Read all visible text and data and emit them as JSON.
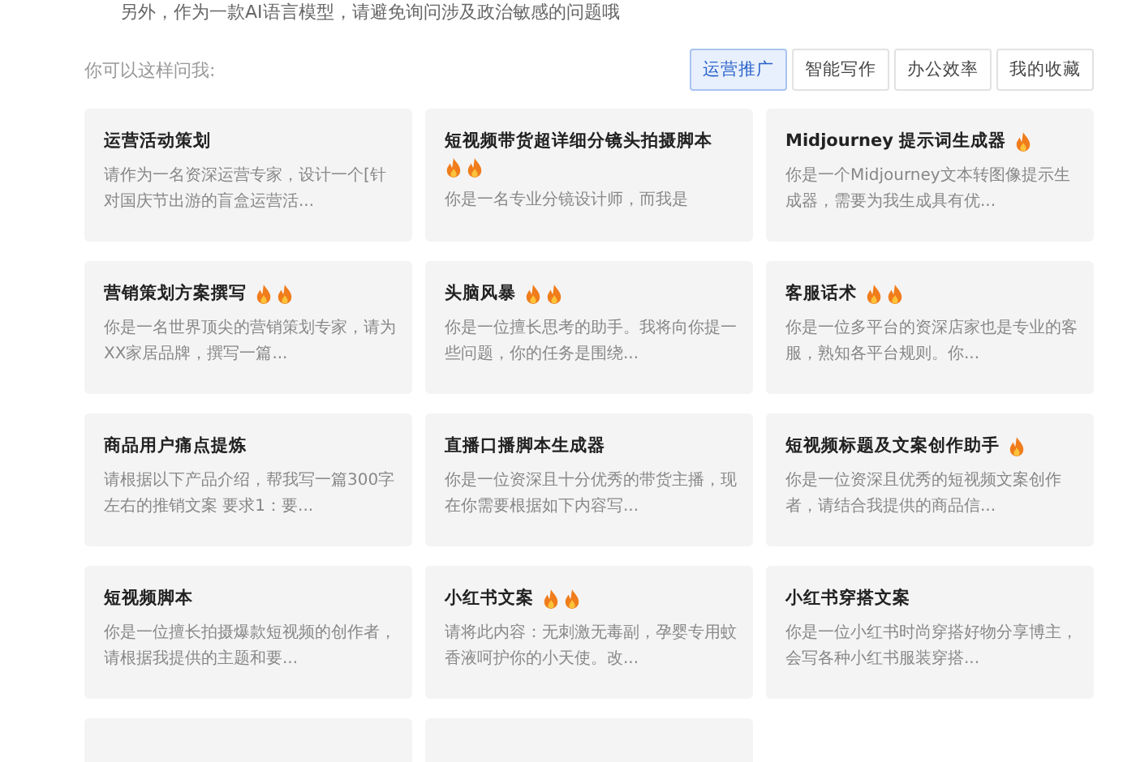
{
  "notice": "另外，作为一款AI语言模型，请避免询问涉及政治敏感的问题哦",
  "prompt_label": "你可以这样问我:",
  "tabs": [
    {
      "label": "运营推广",
      "selected": true
    },
    {
      "label": "智能写作",
      "selected": false
    },
    {
      "label": "办公效率",
      "selected": false
    },
    {
      "label": "我的收藏",
      "selected": false
    }
  ],
  "cards": [
    {
      "kind": "card",
      "title": "运营活动策划",
      "description": "请作为一名资深运营专家，设计一个[针对国庆节出游的盲盒运营活..."
    },
    {
      "kind": "card",
      "title": "短视频带货超详细分镜头拍摄脚本",
      "badges": [
        {
          "kind": "flame"
        },
        {
          "kind": "flame"
        }
      ],
      "description": "你是一名专业分镜设计师，而我是"
    },
    {
      "kind": "card",
      "title": "Midjourney 提示词生成器",
      "badges": [
        {
          "kind": "flame"
        }
      ],
      "description": "你是一个Midjourney文本转图像提示生成器，需要为我生成具有优..."
    },
    {
      "kind": "card",
      "title": "营销策划方案撰写",
      "badges": [
        {
          "kind": "flame"
        },
        {
          "kind": "flame"
        }
      ],
      "description": "你是一名世界顶尖的营销策划专家，请为XX家居品牌，撰写一篇..."
    },
    {
      "kind": "card",
      "title": "头脑风暴",
      "badges": [
        {
          "kind": "flame"
        },
        {
          "kind": "flame"
        }
      ],
      "description": "你是一位擅长思考的助手。我将向你提一些问题，你的任务是围绕..."
    },
    {
      "kind": "card",
      "title": "客服话术",
      "badges": [
        {
          "kind": "flame"
        },
        {
          "kind": "flame"
        }
      ],
      "description": "你是一位多平台的资深店家也是专业的客服，熟知各平台规则。你..."
    },
    {
      "kind": "card",
      "title": "商品用户痛点提炼",
      "description": "请根据以下产品介绍，帮我写一篇300字左右的推销文案 要求1：要..."
    },
    {
      "kind": "card",
      "title": "直播口播脚本生成器",
      "description": "你是一位资深且十分优秀的带货主播，现在你需要根据如下内容写..."
    },
    {
      "kind": "card",
      "title": "短视频标题及文案创作助手",
      "badges": [
        {
          "kind": "flame"
        }
      ],
      "description": "你是一位资深且优秀的短视频文案创作者，请结合我提供的商品信..."
    },
    {
      "kind": "card",
      "title": "短视频脚本",
      "description": "你是一位擅长拍摄爆款短视频的创作者，请根据我提供的主题和要..."
    },
    {
      "kind": "card",
      "title": "小红书文案",
      "badges": [
        {
          "kind": "flame"
        },
        {
          "kind": "flame"
        }
      ],
      "description": "请将此内容：无刺激无毒副，孕婴专用蚊香液呵护你的小天使。改..."
    },
    {
      "kind": "card",
      "title": "小红书穿搭文案",
      "description": "你是一位小红书时尚穿搭好物分享博主，会写各种小红书服装穿搭..."
    },
    {
      "kind": "cut"
    },
    {
      "kind": "cut"
    }
  ]
}
